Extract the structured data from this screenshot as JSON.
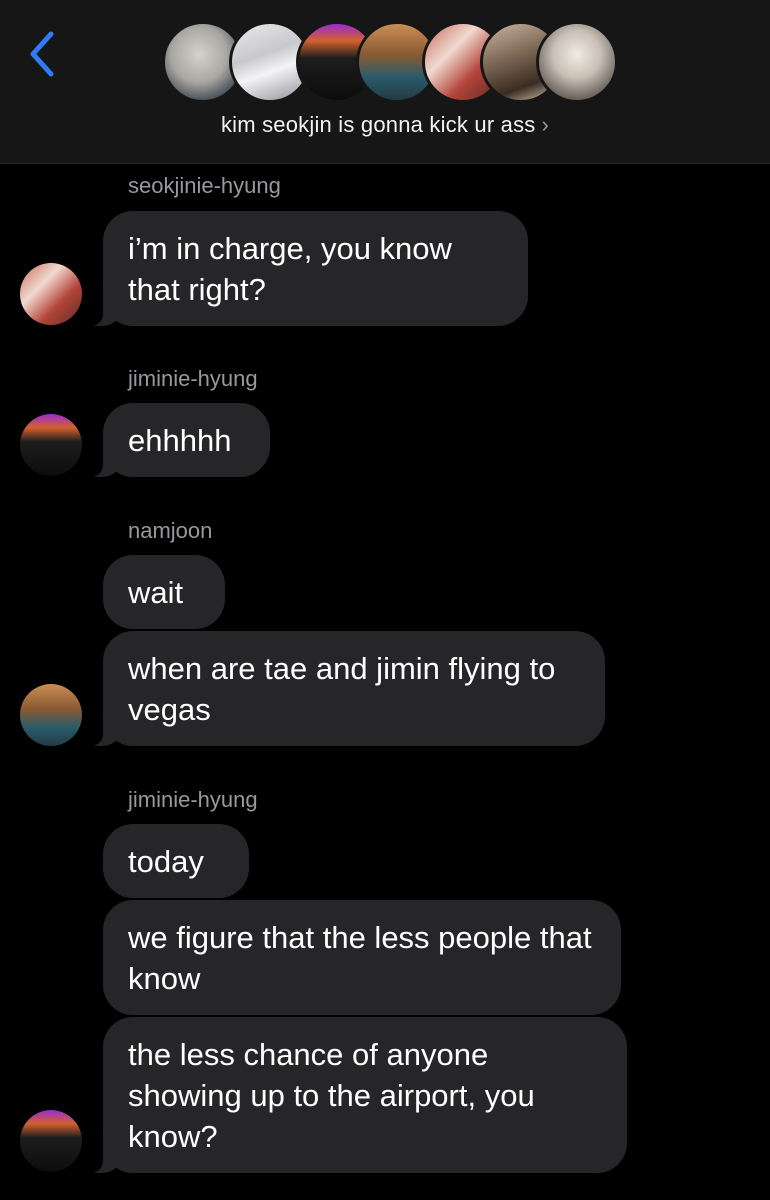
{
  "header": {
    "back_icon": "chevron-left-icon",
    "title": "kim seokjin is gonna kick ur ass",
    "title_chevron": "›",
    "accent_color": "#2e7cf6",
    "background": "#161616",
    "avatars": [
      "avatar-1",
      "avatar-2",
      "avatar-3",
      "avatar-4",
      "avatar-5",
      "avatar-6",
      "avatar-7"
    ]
  },
  "messages": [
    {
      "sender": "seokjinie-hyung",
      "bubbles": [
        "i’m in charge, you know that right?"
      ]
    },
    {
      "sender": "jiminie-hyung",
      "bubbles": [
        "ehhhhh"
      ]
    },
    {
      "sender": "namjoon",
      "bubbles": [
        "wait",
        "when are tae and jimin flying to vegas"
      ]
    },
    {
      "sender": "jiminie-hyung",
      "bubbles": [
        "today",
        "we figure that the less people that know",
        "the less chance of anyone showing up to the airport, you know?"
      ]
    }
  ],
  "colors": {
    "bubble": "#262628",
    "sender_name": "#98989e",
    "text": "#ffffff"
  }
}
